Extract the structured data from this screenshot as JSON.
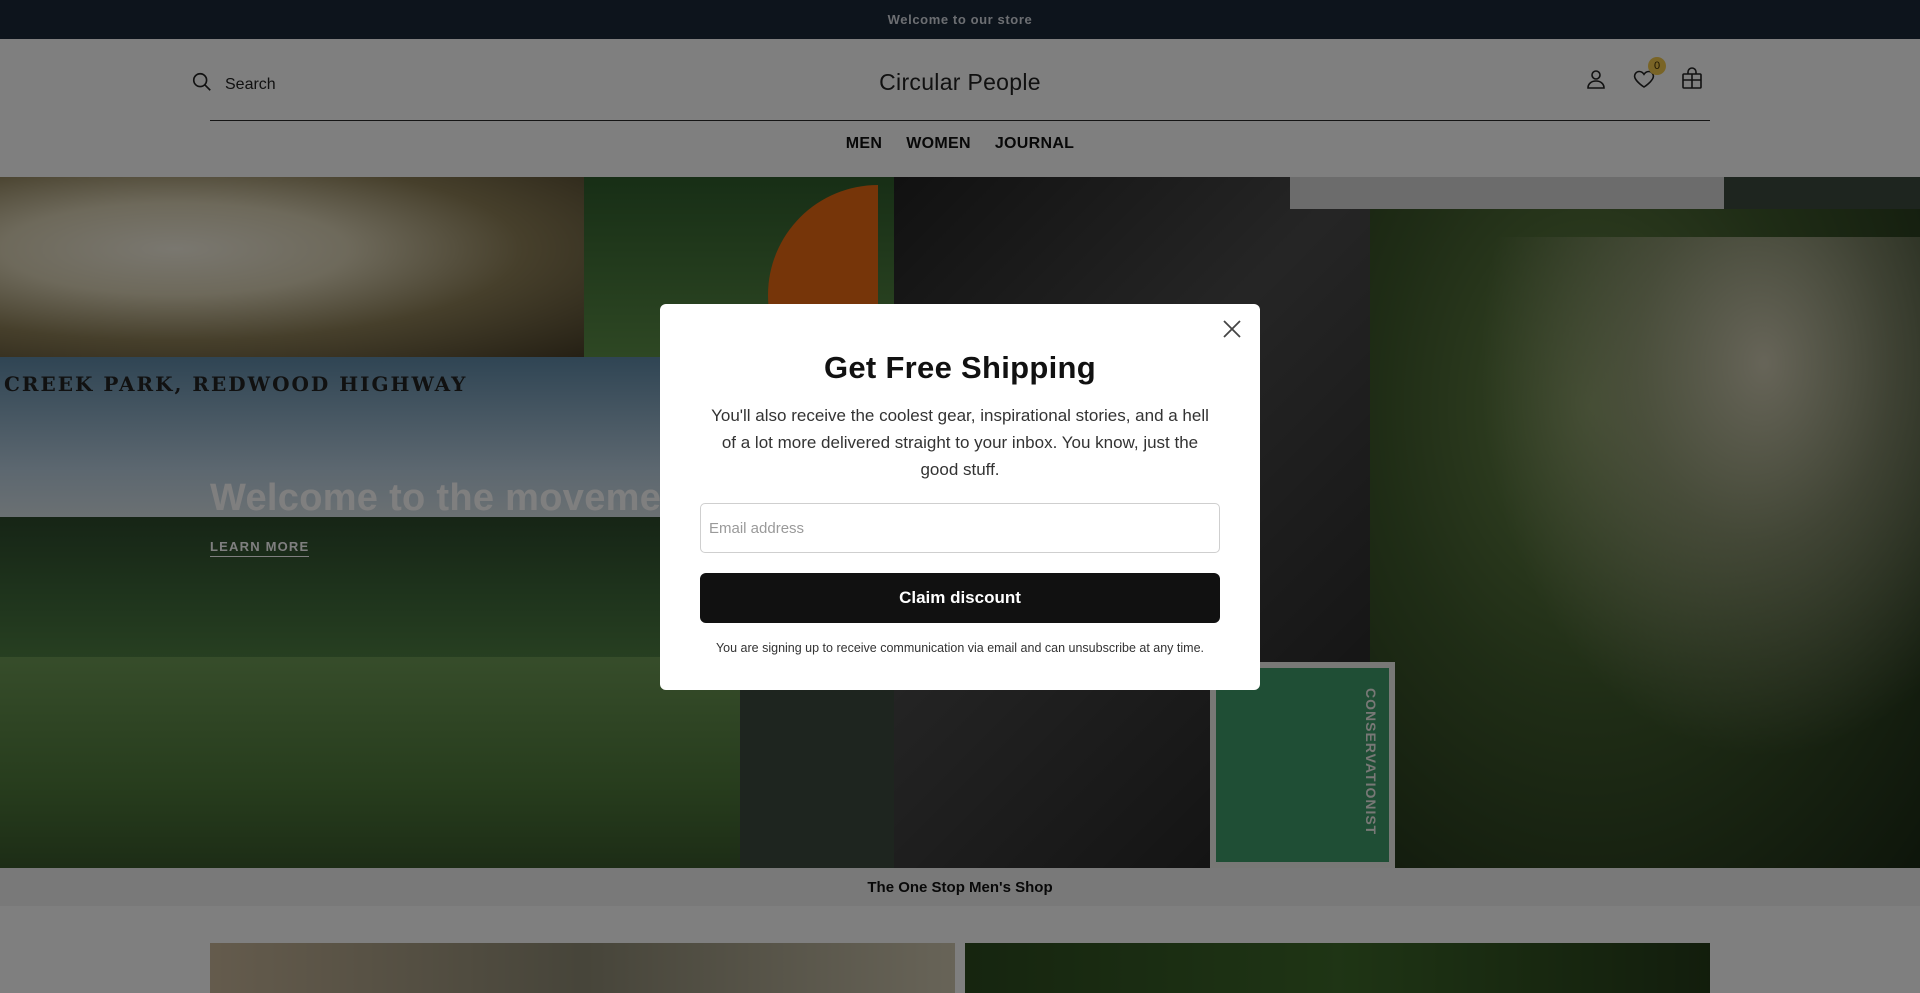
{
  "announcement": "Welcome to our store",
  "header": {
    "search_label": "Search",
    "brand": "Circular People",
    "wishlist_count": "0"
  },
  "nav": {
    "items": [
      "MEN",
      "WOMEN",
      "JOURNAL"
    ]
  },
  "hero": {
    "postcard_caption": "CREEK PARK, REDWOOD HIGHWAY",
    "stamp_caption": "CONSERVATIONIST",
    "title": "Welcome to the movement",
    "link": "LEARN MORE"
  },
  "strip": {
    "title": "The One Stop Men's Shop"
  },
  "modal": {
    "title": "Get Free Shipping",
    "body": "You'll also receive the coolest gear, inspirational stories, and a hell of a lot more delivered straight to your inbox. You know, just the good stuff.",
    "email_placeholder": "Email address",
    "button_label": "Claim discount",
    "note": "You are signing up to receive communication via email and can unsubscribe at any time."
  },
  "icons": {
    "search": "search-icon",
    "account": "user-icon",
    "wishlist": "heart-icon",
    "cart": "bag-icon",
    "close": "close-icon"
  },
  "colors": {
    "announcement_bg": "#1b2838",
    "badge": "#f2c94c",
    "button_bg": "#111111",
    "overlay": "rgba(0,0,0,0.5)"
  }
}
